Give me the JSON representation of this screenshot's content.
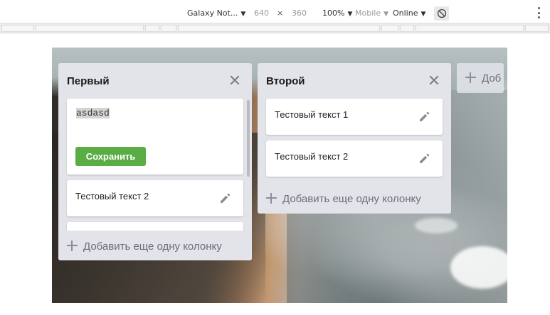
{
  "devtools": {
    "device": "Galaxy Not...",
    "width": "640",
    "times": "×",
    "height": "360",
    "zoom": "100%",
    "mode": "Mobile",
    "network": "Online",
    "rotate_icon": "rotate-icon",
    "more_icon": "more-vertical-icon"
  },
  "board": {
    "columns": [
      {
        "title": "Первый",
        "editor": {
          "value": "asdasd",
          "save_label": "Сохранить"
        },
        "cards": [
          {
            "text": "Тестовый текст 2"
          }
        ],
        "add_label": "Добавить еще одну колонку"
      },
      {
        "title": "Второй",
        "cards": [
          {
            "text": "Тестовый текст 1"
          },
          {
            "text": "Тестовый текст 2"
          }
        ],
        "add_label": "Добавить еще одну колонку"
      }
    ],
    "new_column_label": "Доб"
  },
  "colors": {
    "column_bg": "#e2e4e9",
    "save_button": "#5aac44",
    "card_bg": "#ffffff"
  }
}
